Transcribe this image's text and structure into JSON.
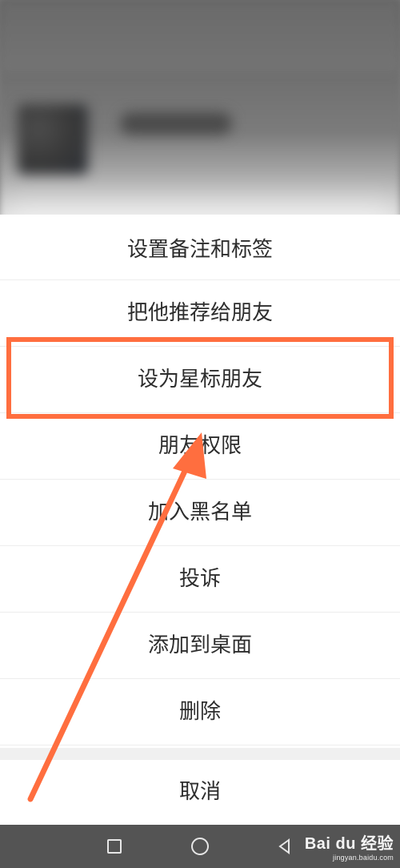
{
  "menu": {
    "items": [
      {
        "label": "设置备注和标签"
      },
      {
        "label": "把他推荐给朋友"
      },
      {
        "label": "设为星标朋友"
      },
      {
        "label": "朋友权限"
      },
      {
        "label": "加入黑名单"
      },
      {
        "label": "投诉"
      },
      {
        "label": "添加到桌面"
      },
      {
        "label": "删除"
      }
    ],
    "cancel_label": "取消"
  },
  "annotation": {
    "highlight_color": "#ff6e3f",
    "arrow_color": "#ff6e3f"
  },
  "watermark": {
    "main": "Bai du 经验",
    "sub": "jingyan.baidu.com"
  },
  "navigation": {
    "icons": [
      "square-icon",
      "circle-icon",
      "triangle-back-icon"
    ]
  }
}
